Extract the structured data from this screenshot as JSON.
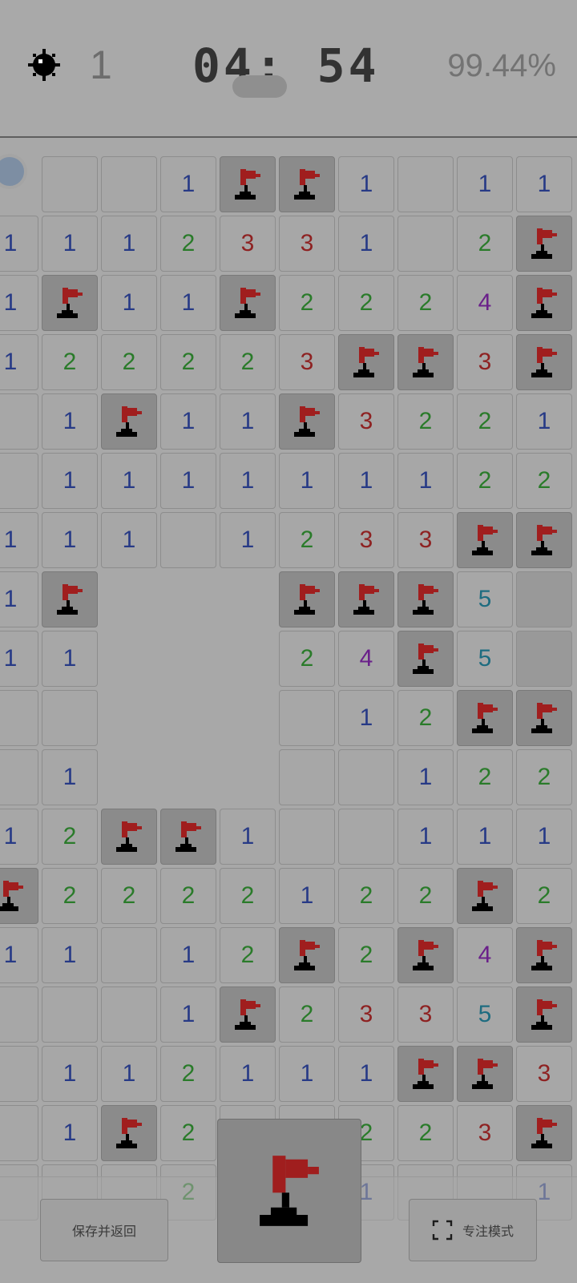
{
  "header": {
    "mine_icon": "mine-icon",
    "mines_remaining": "1",
    "timer": "04: 54",
    "timer_badge": "",
    "progress": "99.44%"
  },
  "board": {
    "rows": [
      [
        "A",
        "",
        "",
        "1",
        "F",
        "F",
        "1",
        "",
        "1",
        "1"
      ],
      [
        "1",
        "1",
        "1",
        "2",
        "3",
        "3",
        "1",
        "",
        "2",
        "F"
      ],
      [
        "1",
        "F",
        "1",
        "1",
        "F",
        "2",
        "2",
        "2",
        "4",
        "F"
      ],
      [
        "1",
        "2",
        "2",
        "2",
        "2",
        "3",
        "F",
        "F",
        "3",
        "F"
      ],
      [
        "",
        "1",
        "F",
        "1",
        "1",
        "F",
        "3",
        "2",
        "2",
        "1"
      ],
      [
        "",
        "1",
        "1",
        "1",
        "1",
        "1",
        "1",
        "1",
        "2",
        "2"
      ],
      [
        "1",
        "1",
        "1",
        "",
        "1",
        "2",
        "3",
        "3",
        "F",
        "F"
      ],
      [
        "1",
        "F",
        "E",
        "E",
        "E",
        "F",
        "F",
        "F",
        "5",
        "C"
      ],
      [
        "1",
        "1",
        "E",
        "E",
        "E",
        "2",
        "4",
        "F",
        "5",
        "C"
      ],
      [
        "",
        "",
        "E",
        "E",
        "E",
        "",
        "1",
        "2",
        "F",
        "F"
      ],
      [
        "",
        "1",
        "E",
        "E",
        "E",
        "",
        "",
        "1",
        "2",
        "2"
      ],
      [
        "1",
        "2",
        "F",
        "F",
        "1",
        "",
        "",
        "1",
        "1",
        "1"
      ],
      [
        "F",
        "2",
        "2",
        "2",
        "2",
        "1",
        "2",
        "2",
        "F",
        "2"
      ],
      [
        "1",
        "1",
        "",
        "1",
        "2",
        "F",
        "2",
        "F",
        "4",
        "F"
      ],
      [
        "",
        "",
        "",
        "1",
        "F",
        "2",
        "3",
        "3",
        "5",
        "F"
      ],
      [
        "",
        "1",
        "1",
        "2",
        "1",
        "1",
        "1",
        "F",
        "F",
        "3"
      ],
      [
        "",
        "1",
        "F",
        "2",
        "",
        "",
        "2",
        "2",
        "3",
        "F"
      ],
      [
        "",
        "",
        "",
        "2",
        "",
        "",
        "1",
        "",
        "",
        "1"
      ]
    ]
  },
  "controls": {
    "save_label": "保存并返回",
    "focus_label": "专注模式",
    "mode_icon": "flag-icon",
    "focus_icon": "fullscreen-icon"
  },
  "colors": {
    "n1": "#273a86",
    "n2": "#2a7b2a",
    "n3": "#8e2222",
    "n4": "#6a1f8a",
    "n5": "#1e6c80",
    "flag": "#a01e1e"
  }
}
